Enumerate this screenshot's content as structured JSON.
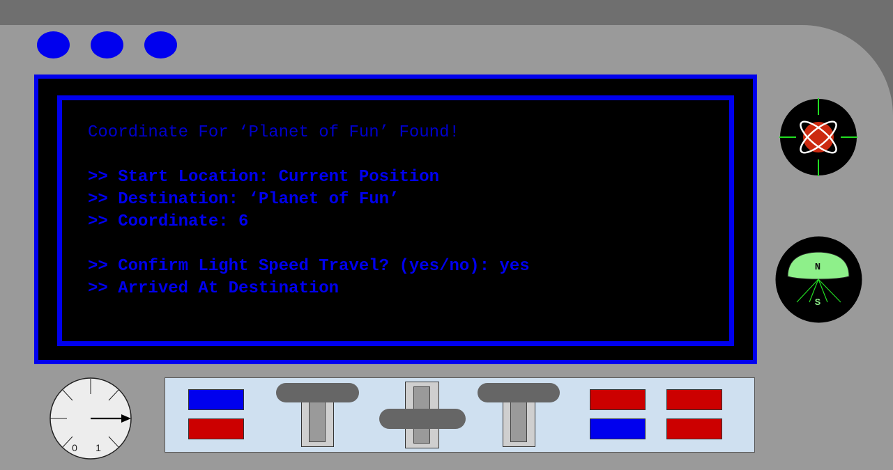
{
  "indicator_lights": [
    {
      "color": "#0000ee"
    },
    {
      "color": "#0000ee"
    },
    {
      "color": "#0000ee"
    }
  ],
  "terminal": {
    "title": "Coordinate For ‘Planet of Fun’ Found!",
    "lines": [
      ">> Start Location: Current Position",
      ">> Destination: ‘Planet of Fun’",
      ">> Coordinate: 6",
      "",
      ">> Confirm Light Speed Travel? (yes/no): yes",
      ">> Arrived At Destination"
    ],
    "text_color": "#0000ee",
    "border_color": "#0000ee"
  },
  "compass": {
    "north_label": "N",
    "south_label": "S"
  },
  "speed_dial": {
    "tick_labels": [
      "0",
      "1"
    ]
  },
  "control_panel": {
    "left_buttons": [
      {
        "color": "#0000ee"
      },
      {
        "color": "#cc0000"
      }
    ],
    "right_buttons": [
      {
        "color": "#cc0000"
      },
      {
        "color": "#cc0000"
      },
      {
        "color": "#0000ee"
      },
      {
        "color": "#cc0000"
      }
    ],
    "levers": [
      {
        "position": "top"
      },
      {
        "position": "bottom"
      },
      {
        "position": "top"
      }
    ]
  }
}
